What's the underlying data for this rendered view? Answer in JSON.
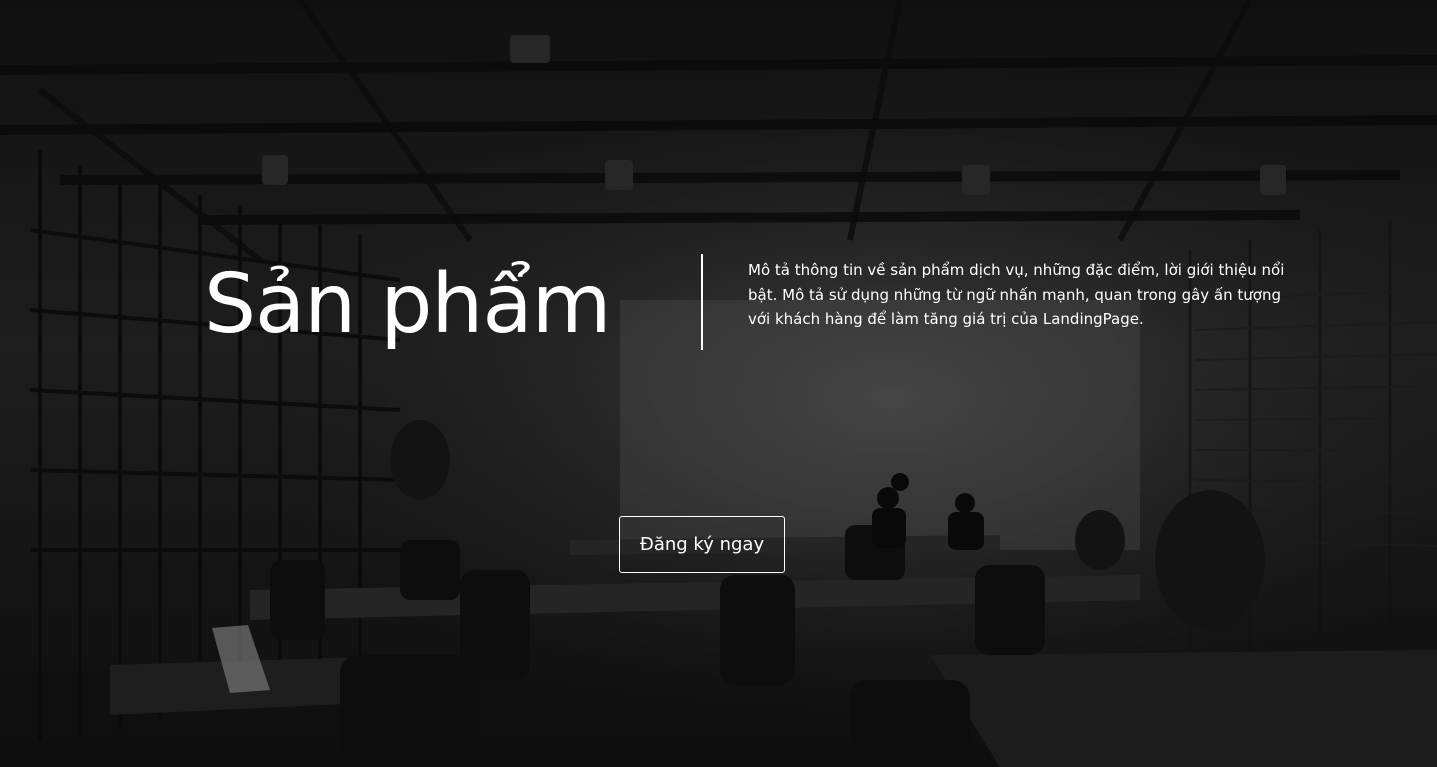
{
  "hero": {
    "title": "Sản phẩm",
    "description": "Mô tả thông tin về sản phẩm dịch vụ, những đặc điểm, lời giới thiệu nổi bật. Mô tả sử dụng những từ ngữ nhấn mạnh, quan trong gây ấn tượng với khách hàng để làm tăng giá trị của LandingPage.",
    "cta_label": "Đăng ký ngay",
    "background_image": "office-interior-photo"
  },
  "colors": {
    "text": "#ffffff",
    "overlay": "#000000"
  }
}
